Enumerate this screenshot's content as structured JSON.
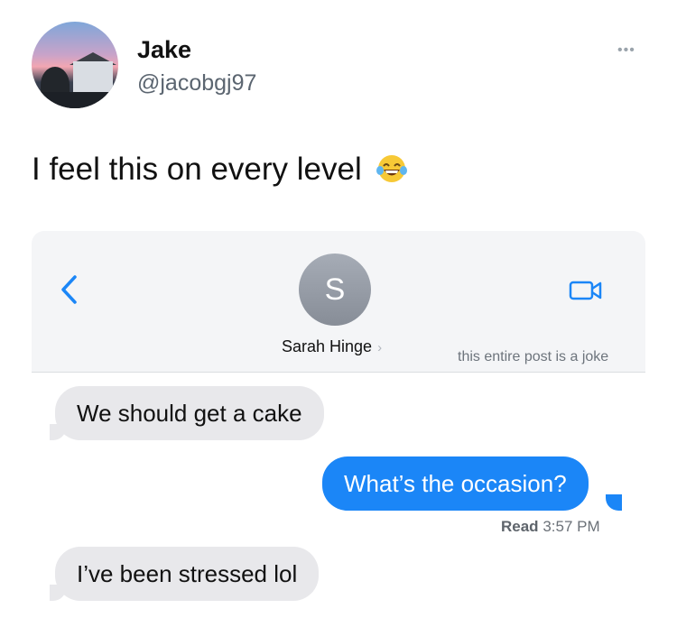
{
  "tweet": {
    "author_name": "Jake",
    "author_handle": "@jacobgj97",
    "more_label": "•••",
    "text": "I feel this on every level",
    "emoji": "face-with-tears-of-joy"
  },
  "messages_screen": {
    "contact_initial": "S",
    "contact_name": "Sarah Hinge",
    "contact_chevron": "›",
    "overlay_note": "this entire post is a joke",
    "back_icon": "chevron-left-icon",
    "video_icon": "video-camera-icon",
    "accent_color": "#1b86f7",
    "messages": [
      {
        "direction": "incoming",
        "text": "We should get a cake"
      },
      {
        "direction": "outgoing",
        "text": "What’s the occasion?"
      },
      {
        "direction": "incoming",
        "text": "I’ve been stressed lol"
      }
    ],
    "read_label": "Read",
    "read_time": "3:57 PM"
  }
}
